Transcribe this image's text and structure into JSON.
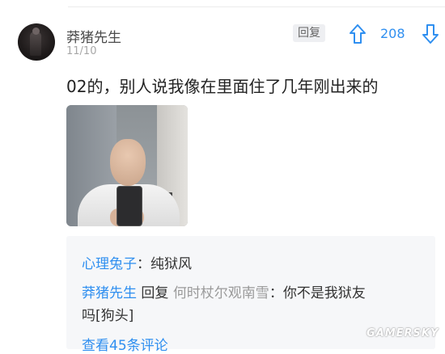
{
  "comment": {
    "author": "莽猪先生",
    "date": "11/10",
    "text": "02的，别人说我像在里面住了几年刚出来的",
    "reply_label": "回复",
    "vote_count": "208",
    "icons": {
      "upvote": "arrow-up-icon",
      "downvote": "arrow-down-icon"
    }
  },
  "replies": [
    {
      "author": "心理兔子",
      "separator": "：",
      "text": "纯狱风"
    },
    {
      "author": "莽猪先生",
      "reply_word": " 回复 ",
      "target": "何时杖尔观南雪",
      "separator": "：",
      "text": "你不是我狱友",
      "text_cont": "吗[狗头]"
    }
  ],
  "more_comments": "查看45条评论",
  "watermark": "GAMERSKY",
  "colors": {
    "accent": "#2f8ff0",
    "muted": "#a7a7a7",
    "reply_bg": "#f6f7f9"
  }
}
